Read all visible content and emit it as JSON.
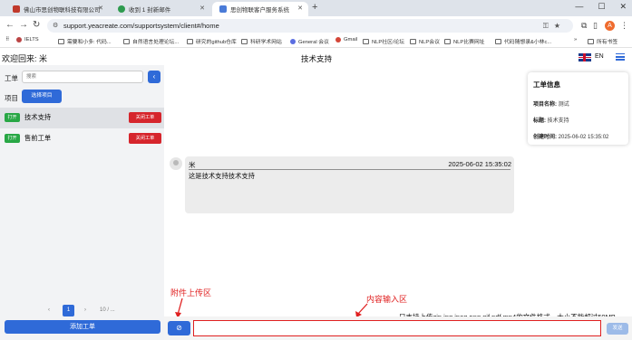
{
  "browser": {
    "tabs": [
      {
        "label": "佛山市思创物联科技有限公司",
        "active": false,
        "color": "#c0392b"
      },
      {
        "label": "收到 1 封新邮件",
        "active": false,
        "color": "#2e9b4f"
      },
      {
        "label": "思创物联客户服务系统",
        "active": true,
        "color": "#4a7bd8"
      }
    ],
    "url": "support.yeacreate.com/supportsystem/client#/home",
    "profile_initial": "A",
    "bookmarks": [
      "IELTS",
      "需要和小多: 代码...",
      "自然语言处理论坛...",
      "研究的github仓库",
      "科研学术网站",
      "General 会议",
      "Gmail",
      "NLP社区/论坛",
      "NLP会议",
      "NLP比赛网址",
      "代码随想录&小林c...",
      "所有书签"
    ]
  },
  "header": {
    "welcome": "欢迎回来: 米",
    "title": "技术支持",
    "lang": "EN"
  },
  "sidebar": {
    "ticket_label": "工单",
    "search_placeholder": "搜索",
    "collapse_icon": "‹",
    "project_label": "项目",
    "select_project": "选择项目",
    "tickets": [
      {
        "badge": "打开",
        "name": "技术支持",
        "close": "关闭工单",
        "selected": true
      },
      {
        "badge": "打开",
        "name": "售前工单",
        "close": "关闭工单",
        "selected": false
      }
    ],
    "pager": {
      "prev": "‹",
      "current": "1",
      "next": "›",
      "size": "10 / ..."
    },
    "add_ticket": "添加工单"
  },
  "info": {
    "title": "工单信息",
    "rows": [
      {
        "label": "项目名称:",
        "value": "测试"
      },
      {
        "label": "标题:",
        "value": "技术支持"
      },
      {
        "label": "创建时间:",
        "value": "2025-06-02 15:35:02"
      }
    ]
  },
  "message": {
    "user": "米",
    "time": "2025-06-02 15:35:02",
    "text": "这是技术支持技术支持"
  },
  "annotations": {
    "attach": "附件上传区",
    "input": "内容输入区"
  },
  "composer": {
    "hint": "只支持上传zip,jpg,jpeg,png,gif,pdf,mp4的文件格式，大小不能超过50MB",
    "attach_icon": "⊘",
    "input_value": "",
    "send": "发送"
  },
  "colors": {
    "primary": "#2f6ad8",
    "danger": "#d6252c",
    "success": "#28a745",
    "annotation": "#e02020"
  }
}
